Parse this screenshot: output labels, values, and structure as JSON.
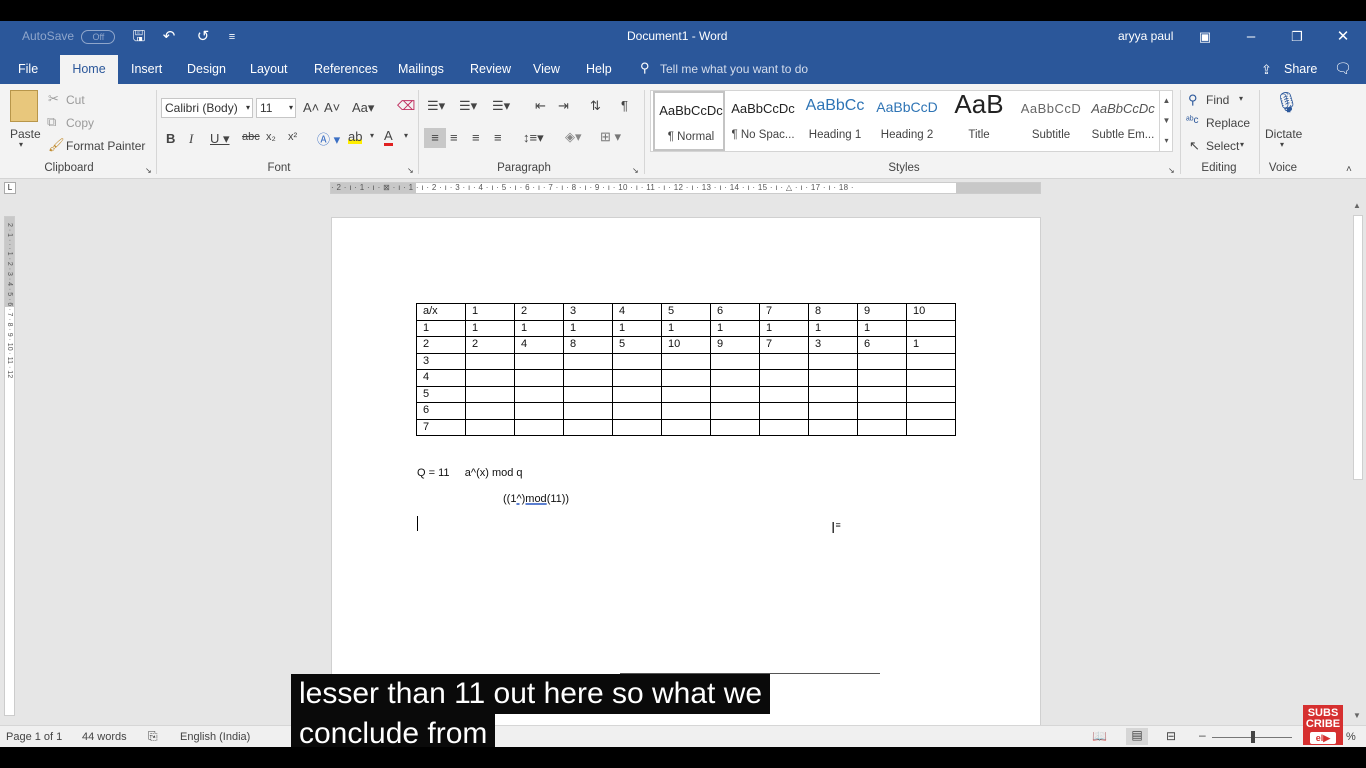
{
  "titlebar": {
    "autosave_label": "AutoSave",
    "autosave_state": "Off",
    "document_title": "Document1  -  Word",
    "user_name": "aryya paul"
  },
  "menu": {
    "file": "File",
    "home": "Home",
    "insert": "Insert",
    "design": "Design",
    "layout": "Layout",
    "references": "References",
    "mailings": "Mailings",
    "review": "Review",
    "view": "View",
    "help": "Help",
    "tell_me": "Tell me what you want to do",
    "share": "Share"
  },
  "ribbon": {
    "clipboard": {
      "paste": "Paste",
      "cut": "Cut",
      "copy": "Copy",
      "format_painter": "Format Painter",
      "label": "Clipboard"
    },
    "font": {
      "font_name": "Calibri (Body)",
      "font_size": "11",
      "label": "Font"
    },
    "paragraph": {
      "label": "Paragraph"
    },
    "styles": {
      "label": "Styles",
      "items": [
        {
          "preview": "AaBbCcDc",
          "name": "¶ Normal"
        },
        {
          "preview": "AaBbCcDc",
          "name": "¶ No Spac..."
        },
        {
          "preview": "AaBbCc",
          "name": "Heading 1"
        },
        {
          "preview": "AaBbCcD",
          "name": "Heading 2"
        },
        {
          "preview": "AaB",
          "name": "Title"
        },
        {
          "preview": "AaBbCcD",
          "name": "Subtitle"
        },
        {
          "preview": "AaBbCcDc",
          "name": "Subtle Em..."
        }
      ]
    },
    "editing": {
      "find": "Find",
      "replace": "Replace",
      "select": "Select",
      "label": "Editing"
    },
    "voice": {
      "dictate": "Dictate",
      "label": "Voice"
    }
  },
  "ruler": {
    "text": "· 2 · ı · 1 · ı · ⊠ · ı · 1 · ı · 2 · ı · 3 · ı · 4 · ı · 5 · ı · 6 · ı · 7 · ı · 8 · ı · 9 · ı · 10 · ı · 11 · ı · 12 · ı · 13 · ı · 14 · ı · 15 · ı · △ · ı · 17 · ı · 18 ·",
    "vertical_text": "2 · 1 · · · 1 · 2 · 3 · 4 · 5 · 6 · 7 · 8 · 9 · 10 · 11 · 12"
  },
  "document": {
    "table": [
      [
        "a/x",
        "1",
        "2",
        "3",
        "4",
        "5",
        "6",
        "7",
        "8",
        "9",
        "10"
      ],
      [
        "1",
        "1",
        "1",
        "1",
        "1",
        "1",
        "1",
        "1",
        "1",
        "1",
        ""
      ],
      [
        "2",
        "2",
        "4",
        "8",
        "5",
        "10",
        "9",
        "7",
        "3",
        "6",
        "1"
      ],
      [
        "3",
        "",
        "",
        "",
        "",
        "",
        "",
        "",
        "",
        "",
        ""
      ],
      [
        "4",
        "",
        "",
        "",
        "",
        "",
        "",
        "",
        "",
        "",
        ""
      ],
      [
        "5",
        "",
        "",
        "",
        "",
        "",
        "",
        "",
        "",
        "",
        ""
      ],
      [
        "6",
        "",
        "",
        "",
        "",
        "",
        "",
        "",
        "",
        "",
        ""
      ],
      [
        "7",
        "",
        "",
        "",
        "",
        "",
        "",
        "",
        "",
        "",
        ""
      ]
    ],
    "formula_line1": "Q = 11     a^(x) mod q",
    "formula_line2_pre": "((1",
    "formula_line2_mid": "^)mod",
    "formula_line2_post": "(11))"
  },
  "statusbar": {
    "page": "Page 1 of 1",
    "words": "44 words",
    "language": "English (India)",
    "zoom_suffix": "%"
  },
  "captions": {
    "line1": "lesser than 11 out here so what we",
    "line2": "conclude from"
  },
  "badge": {
    "line1": "SUBS",
    "line2": "CRIBE",
    "line3": "el▶"
  },
  "colors": {
    "word_blue": "#2b579a",
    "ribbon_bg": "#f3f3f3",
    "badge_red": "#d63030"
  },
  "icons": [
    "save-icon",
    "undo-icon",
    "redo-icon",
    "customize-icon",
    "ribbon-display-icon",
    "minimize-icon",
    "restore-icon",
    "close-icon",
    "search-icon",
    "share-icon",
    "comments-icon",
    "microphone-icon",
    "i-beam-cursor-icon"
  ]
}
